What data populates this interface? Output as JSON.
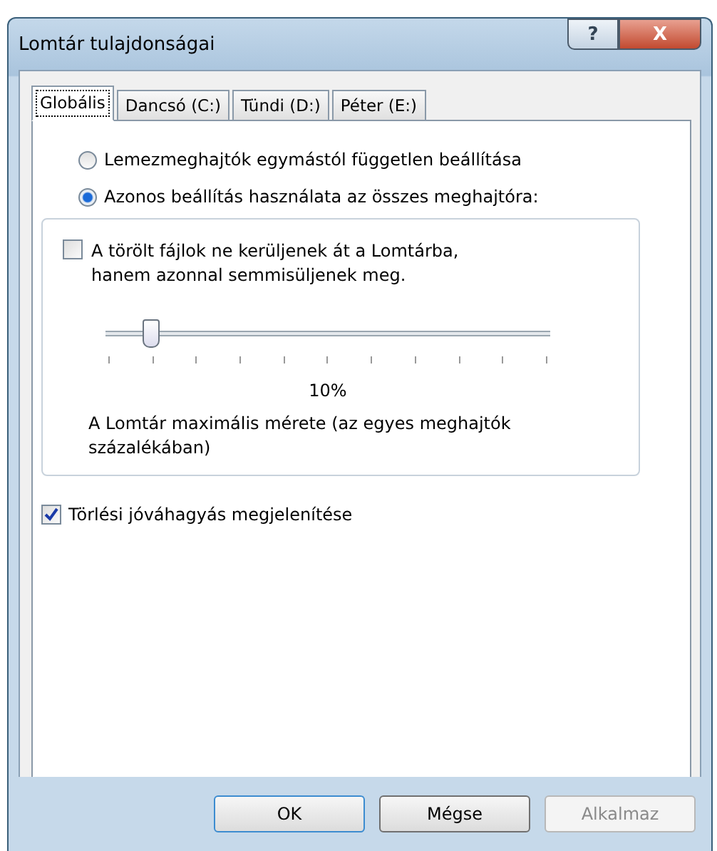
{
  "window": {
    "title": "Lomtár tulajdonságai"
  },
  "title_buttons": [
    {
      "kind": "help",
      "label": "?"
    },
    {
      "kind": "close",
      "label": "X"
    }
  ],
  "tabs": [
    {
      "label": "Globális",
      "selected": true
    },
    {
      "label": "Dancsó (C:)",
      "selected": false
    },
    {
      "label": "Tündi (D:)",
      "selected": false
    },
    {
      "label": "Péter (E:)",
      "selected": false
    }
  ],
  "radios": [
    {
      "label": "Lemezmeghajtók egymástól független beállítása",
      "selected": false
    },
    {
      "label": "Azonos beállítás használata az összes meghajtóra:",
      "selected": true
    }
  ],
  "group_checkbox": {
    "label": "A törölt fájlok ne kerüljenek át a Lomtárba, hanem azonnal semmisüljenek meg.",
    "checked": false
  },
  "slider": {
    "level": 0.1,
    "reading": "10%",
    "caption": "A Lomtár maximális mérete (az egyes meghajtók százalékában)"
  },
  "confirm_checkbox": {
    "label": "Törlési jóváhagyás megjelenítése",
    "checked": true
  },
  "buttons": [
    {
      "label": "OK",
      "disabled": false,
      "default": true
    },
    {
      "label": "Mégse",
      "disabled": false,
      "default": false
    },
    {
      "label": "Alkalmaz",
      "disabled": true,
      "default": false
    }
  ]
}
